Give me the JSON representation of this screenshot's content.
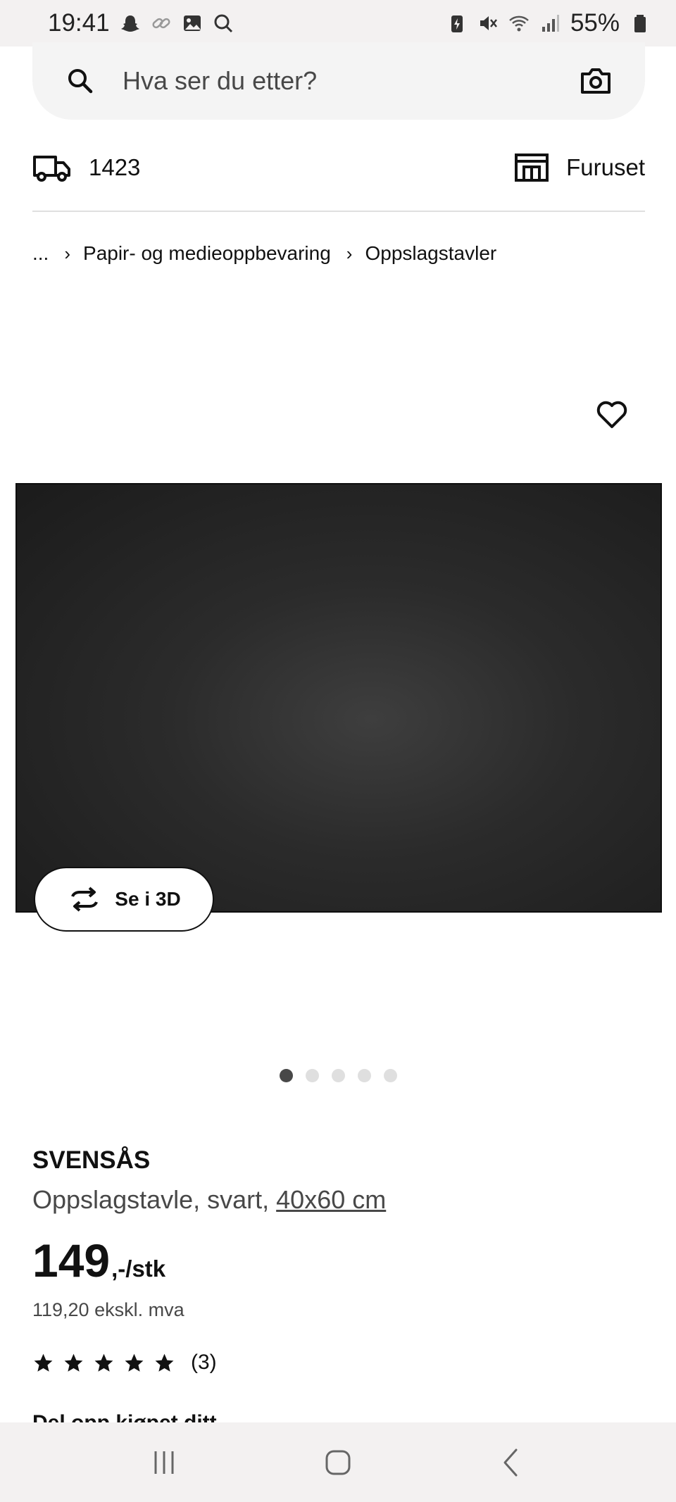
{
  "status_bar": {
    "time": "19:41",
    "battery": "55%"
  },
  "search": {
    "placeholder": "Hva ser du etter?"
  },
  "delivery": {
    "postcode": "1423",
    "store": "Furuset"
  },
  "breadcrumb": {
    "ellipsis": "...",
    "items": [
      "Papir- og medieoppbevaring",
      "Oppslagstavler"
    ]
  },
  "gallery": {
    "view_3d_label": "Se i 3D",
    "total_images": 5,
    "active_index": 0
  },
  "product": {
    "name": "SVENSÅS",
    "description": "Oppslagstavle, svart, ",
    "size_link": "40x60 cm",
    "price": "149",
    "price_suffix": ",-/stk",
    "price_excl_vat": "119,20 ekskl. mva",
    "rating": 5,
    "rating_count": "(3)",
    "share_prompt": "Del opp kjøpet ditt"
  },
  "colors": {
    "accent": "#111111",
    "secondary_text": "#484848",
    "image_bg": "#2b2b2b",
    "chrome_bg": "#f3f1f1"
  }
}
